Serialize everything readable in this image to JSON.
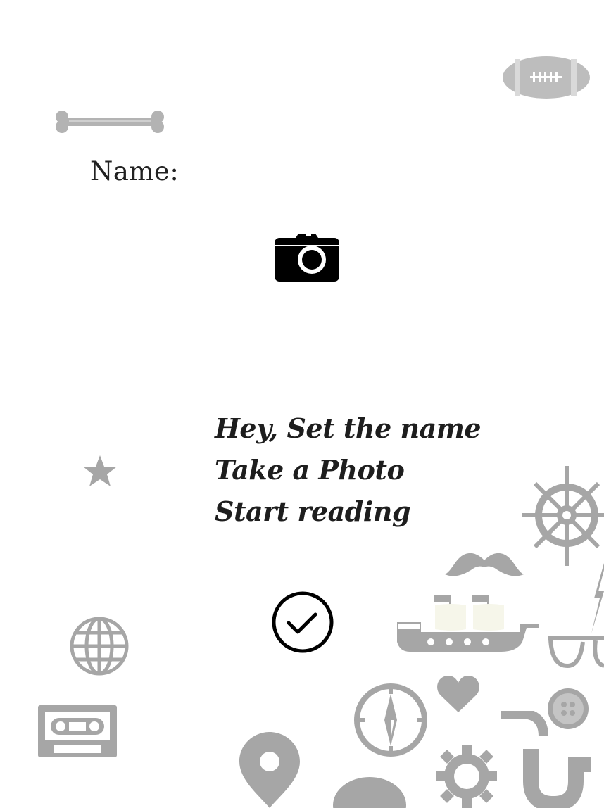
{
  "form": {
    "name_label": "Name:"
  },
  "instructions": {
    "line1": "Hey, Set the name",
    "line2": "Take a Photo",
    "line3": "Start reading"
  },
  "icons": {
    "camera": "camera-icon",
    "confirm": "check-circle-icon"
  },
  "colors": {
    "background": "#ffffff",
    "text": "#1e1e1e",
    "decoration": "#b3b3b3"
  }
}
